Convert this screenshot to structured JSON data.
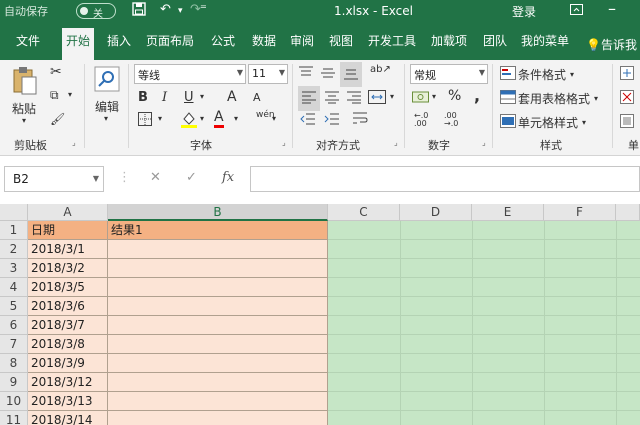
{
  "titlebar": {
    "autosave_label": "自动保存",
    "autosave_state": "关",
    "title": "1.xlsx  -  Excel",
    "login": "登录"
  },
  "tabs": [
    "文件",
    "开始",
    "插入",
    "页面布局",
    "公式",
    "数据",
    "审阅",
    "视图",
    "开发工具",
    "加载项",
    "团队",
    "我的菜单"
  ],
  "active_tab": "开始",
  "tell_me": "告诉我",
  "ribbon": {
    "clipboard": {
      "paste": "粘贴",
      "label": "剪贴板"
    },
    "editing": {
      "label": "编辑"
    },
    "font": {
      "name": "等线",
      "size": "11",
      "bold": "B",
      "italic": "I",
      "underline": "U",
      "label": "字体",
      "grow": "A",
      "shrink": "A",
      "font_color": "A",
      "phonetic": "wén"
    },
    "alignment": {
      "label": "对齐方式"
    },
    "number": {
      "format": "常规",
      "percent": "%",
      "comma": ",",
      "label": "数字"
    },
    "styles": {
      "conditional": "条件格式",
      "table": "套用表格格式",
      "cell": "单元格样式",
      "label": "样式"
    },
    "cells": {
      "label": "单"
    }
  },
  "formula_bar": {
    "name_box": "B2",
    "cancel": "✕",
    "enter": "✓",
    "fx": "fx",
    "content": ""
  },
  "columns": [
    "A",
    "B",
    "C",
    "D",
    "E",
    "F"
  ],
  "selected_column": "B",
  "rows": [
    {
      "num": "1",
      "a": "日期",
      "b": "结果1"
    },
    {
      "num": "2",
      "a": "2018/3/1",
      "b": ""
    },
    {
      "num": "3",
      "a": "2018/3/2",
      "b": ""
    },
    {
      "num": "4",
      "a": "2018/3/5",
      "b": ""
    },
    {
      "num": "5",
      "a": "2018/3/6",
      "b": ""
    },
    {
      "num": "6",
      "a": "2018/3/7",
      "b": ""
    },
    {
      "num": "7",
      "a": "2018/3/8",
      "b": ""
    },
    {
      "num": "8",
      "a": "2018/3/9",
      "b": ""
    },
    {
      "num": "9",
      "a": "2018/3/12",
      "b": ""
    },
    {
      "num": "10",
      "a": "2018/3/13",
      "b": ""
    },
    {
      "num": "11",
      "a": "2018/3/14",
      "b": ""
    }
  ],
  "colors": {
    "excel_green": "#217346",
    "header_fill": "#f4b183",
    "body_fill": "#fce4d6",
    "green_fill": "#c6e6c6"
  }
}
